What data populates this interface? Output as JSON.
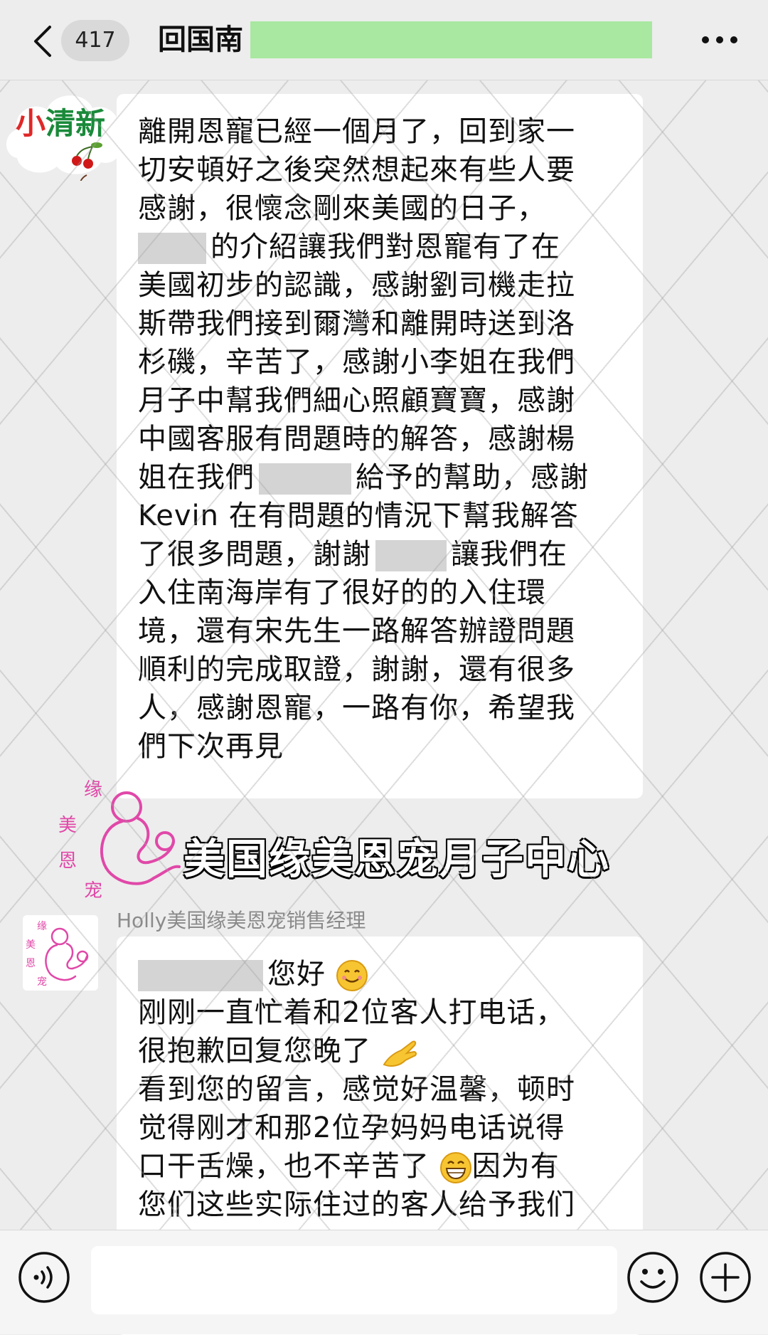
{
  "header": {
    "unread_count": "417",
    "title": "回国南"
  },
  "avatar_cloud": {
    "text_part1": "小",
    "text_part2": "清新"
  },
  "message1": {
    "lines": [
      "離開恩寵已經一個月了，回到家一",
      "切安頓好之後突然想起來有些人要",
      "感謝，很懷念剛來美國的日子，",
      "的介紹讓我們對恩寵有了在",
      "美國初步的認識，感謝劉司機走拉",
      "斯帶我們接到爾灣和離開時送到洛",
      "杉磯，辛苦了，感謝小李姐在我們",
      "月子中幫我們細心照顧寶寶，感謝",
      "中國客服有問題時的解答，感謝楊",
      "姐在我們",
      "給予的幫助，感謝",
      "Kevin 在有問題的情況下幫我解答",
      "了很多問題，謝謝",
      "讓我們在",
      "入住南海岸有了很好的的入住環",
      "境，還有宋先生一路解答辦證問題",
      "順利的完成取證，謝謝，還有很多",
      "人，感謝恩寵，一路有你，希望我",
      "們下次再見"
    ]
  },
  "brand": {
    "logo_chars": [
      "缘",
      "美",
      "恩",
      "宠"
    ],
    "banner_text": "美国缘美恩宠月子中心"
  },
  "message2": {
    "sender": "Holly美国缘美恩宠销售经理",
    "lines": [
      "您好",
      "刚刚一直忙着和2位客人打电话，",
      "很抱歉回复您晚了",
      "看到您的留言，感觉好温馨，顿时",
      "觉得刚才和那2位孕妈妈电话说得",
      "口干舌燥，也不辛苦了",
      "因为有",
      "您们这些实际住过的客人给予我们"
    ],
    "emoji_smile": "smile-emoji",
    "emoji_hand": "hand-emoji",
    "emoji_grin": "grin-emoji"
  },
  "colors": {
    "redaction_green": "#a8e8a0",
    "redaction_gray": "#d4d4d4",
    "brand_pink": "#e048a8"
  },
  "icons": {
    "back": "chevron-left-icon",
    "more": "more-dots-icon",
    "voice": "voice-icon",
    "emoji": "emoji-icon",
    "plus": "plus-icon"
  }
}
